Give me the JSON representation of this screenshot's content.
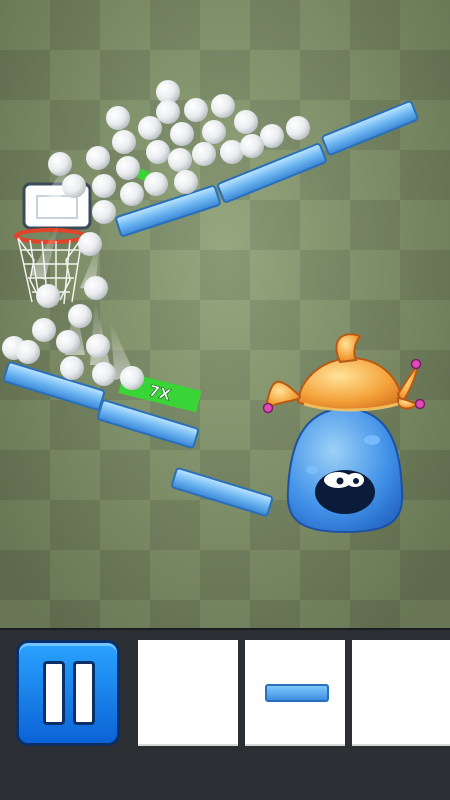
{
  "game": {
    "multiplier_label": "7X"
  },
  "colors": {
    "plank": "#7ec8ff",
    "multiplier_bar": "#39d435",
    "monster_body": "#3f92f0",
    "hat": "#f4a23a",
    "pause_button": "#1a83f0"
  },
  "toolbar": {
    "pause_icon": "pause-icon",
    "slots": [
      {
        "item": "empty"
      },
      {
        "item": "plank"
      },
      {
        "item": "empty"
      }
    ]
  }
}
